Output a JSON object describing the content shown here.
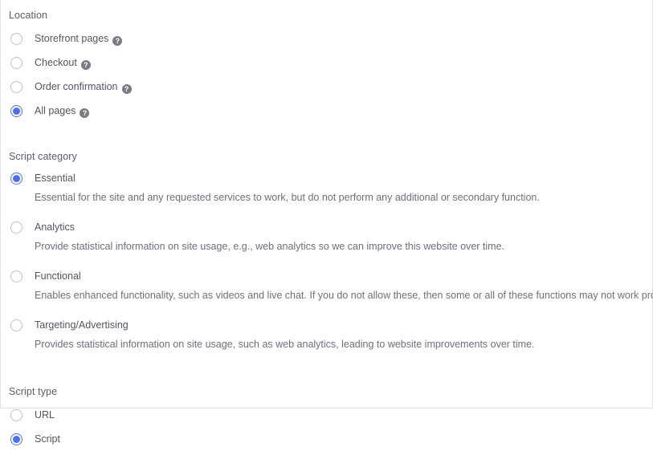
{
  "icons": {
    "help": "?",
    "help_name": "help-icon"
  },
  "colors": {
    "accent": "#4c6ef5",
    "label_text": "#5c5c66",
    "option_text": "#55555f",
    "description_text": "#6f6f79",
    "radio_border": "#c0c0c6",
    "panel_border": "#e2e2e4"
  },
  "location": {
    "label": "Location",
    "options": [
      {
        "label": "Storefront pages",
        "selected": false,
        "has_help": true
      },
      {
        "label": "Checkout",
        "selected": false,
        "has_help": true
      },
      {
        "label": "Order confirmation",
        "selected": false,
        "has_help": true
      },
      {
        "label": "All pages",
        "selected": true,
        "has_help": true
      }
    ]
  },
  "script_category": {
    "label": "Script category",
    "options": [
      {
        "label": "Essential",
        "selected": true,
        "description": "Essential for the site and any requested services to work, but do not perform any additional or secondary function."
      },
      {
        "label": "Analytics",
        "selected": false,
        "description": "Provide statistical information on site usage, e.g., web analytics so we can improve this website over time."
      },
      {
        "label": "Functional",
        "selected": false,
        "description": "Enables enhanced functionality, such as videos and live chat. If you do not allow these, then some or all of these functions may not work properly."
      },
      {
        "label": "Targeting/Advertising",
        "selected": false,
        "description": "Provides statistical information on site usage, such as web analytics, leading to website improvements over time."
      }
    ]
  },
  "script_type": {
    "label": "Script type",
    "options": [
      {
        "label": "URL",
        "selected": false
      },
      {
        "label": "Script",
        "selected": true
      }
    ]
  }
}
